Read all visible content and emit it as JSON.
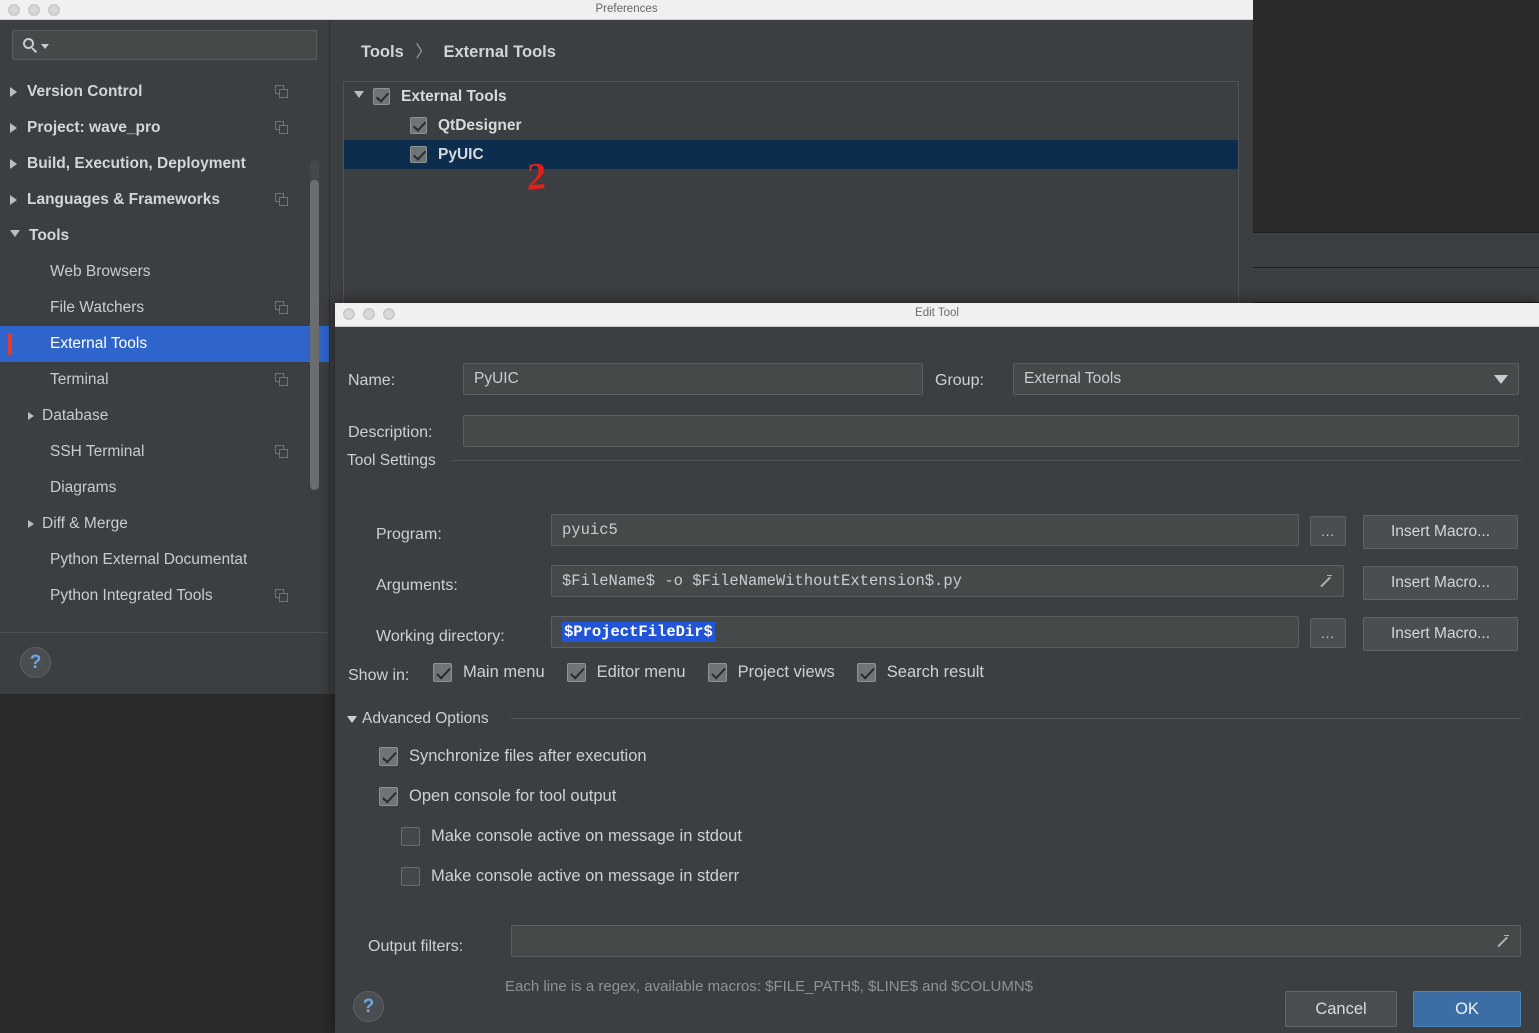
{
  "preferences_window": {
    "title": "Preferences",
    "search": {
      "placeholder": "",
      "value": "",
      "icon": "search-icon"
    },
    "sidebar": {
      "items": [
        {
          "label": "Version Control",
          "level": 0,
          "arrow": "right",
          "copy_icon": true
        },
        {
          "label": "Project: wave_pro",
          "level": 0,
          "arrow": "right",
          "copy_icon": true
        },
        {
          "label": "Build, Execution, Deployment",
          "level": 0,
          "arrow": "right",
          "copy_icon": false
        },
        {
          "label": "Languages & Frameworks",
          "level": 0,
          "arrow": "right",
          "copy_icon": true
        },
        {
          "label": "Tools",
          "level": 0,
          "arrow": "down",
          "copy_icon": false
        },
        {
          "label": "Web Browsers",
          "level": 1,
          "arrow": "none",
          "copy_icon": false
        },
        {
          "label": "File Watchers",
          "level": 1,
          "arrow": "none",
          "copy_icon": true
        },
        {
          "label": "External Tools",
          "level": 1,
          "arrow": "none",
          "copy_icon": false,
          "selected": true
        },
        {
          "label": "Terminal",
          "level": 1,
          "arrow": "none",
          "copy_icon": true
        },
        {
          "label": "Database",
          "level": 1,
          "arrow": "right",
          "copy_icon": false
        },
        {
          "label": "SSH Terminal",
          "level": 1,
          "arrow": "none",
          "copy_icon": true
        },
        {
          "label": "Diagrams",
          "level": 1,
          "arrow": "none",
          "copy_icon": false
        },
        {
          "label": "Diff & Merge",
          "level": 1,
          "arrow": "right",
          "copy_icon": false
        },
        {
          "label": "Python External Documentat",
          "level": 1,
          "arrow": "none",
          "copy_icon": false
        },
        {
          "label": "Python Integrated Tools",
          "level": 1,
          "arrow": "none",
          "copy_icon": true
        }
      ],
      "help_glyph": "?"
    },
    "main": {
      "breadcrumb_root": "Tools",
      "breadcrumb_sep": "〉",
      "breadcrumb_leaf": "External Tools",
      "tree": [
        {
          "label": "External Tools",
          "checked": true,
          "indent": false,
          "expanded": true,
          "selected": false
        },
        {
          "label": "QtDesigner",
          "checked": true,
          "indent": true,
          "expanded": false,
          "selected": false
        },
        {
          "label": "PyUIC",
          "checked": true,
          "indent": true,
          "expanded": false,
          "selected": true
        }
      ]
    }
  },
  "annotations": {
    "step_number": "2",
    "color": "#ee1c16",
    "arrow_count": 3
  },
  "edit_tool_dialog": {
    "title": "Edit Tool",
    "name_label": "Name:",
    "name_value": "PyUIC",
    "group_label": "Group:",
    "group_value": "External Tools",
    "description_label": "Description:",
    "description_value": "",
    "tool_settings_legend": "Tool Settings",
    "program_label": "Program:",
    "program_value": "pyuic5",
    "arguments_label": "Arguments:",
    "arguments_value": "$FileName$ -o $FileNameWithoutExtension$.py",
    "working_dir_label": "Working directory:",
    "working_dir_value": "$ProjectFileDir$",
    "working_dir_selected": true,
    "browse_button_label": "...",
    "insert_macro_label": "Insert Macro...",
    "show_in_label": "Show in:",
    "show_in_options": [
      {
        "label": "Main menu",
        "checked": true
      },
      {
        "label": "Editor menu",
        "checked": true
      },
      {
        "label": "Project views",
        "checked": true
      },
      {
        "label": "Search result",
        "checked": true
      }
    ],
    "advanced_options_legend": "Advanced Options",
    "advanced_options": [
      {
        "label": "Synchronize files after execution",
        "checked": true,
        "indent": false
      },
      {
        "label": "Open console for tool output",
        "checked": true,
        "indent": false
      },
      {
        "label": "Make console active on message in stdout",
        "checked": false,
        "indent": true
      },
      {
        "label": "Make console active on message in stderr",
        "checked": false,
        "indent": true
      }
    ],
    "output_filters_label": "Output filters:",
    "output_filters_value": "",
    "output_filters_hint": "Each line is a regex, available macros: $FILE_PATH$, $LINE$ and $COLUMN$",
    "help_glyph": "?",
    "cancel_label": "Cancel",
    "ok_label": "OK",
    "accent_color": "#3c6ea5"
  }
}
